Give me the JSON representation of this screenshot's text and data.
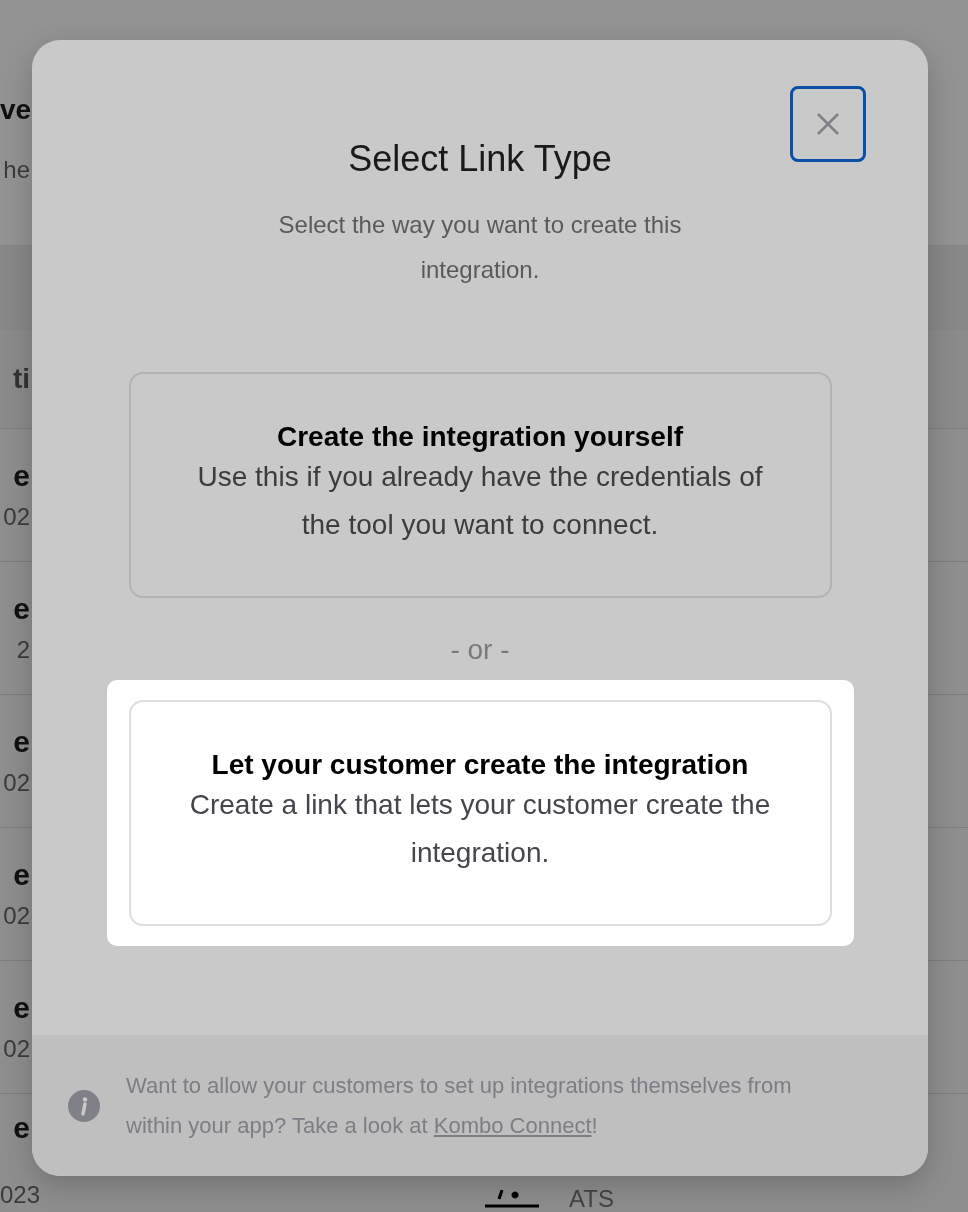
{
  "background": {
    "title": "ve",
    "subtitle": "he",
    "table_header": "ti",
    "rows": [
      {
        "name": "e",
        "date": "02"
      },
      {
        "name": "e",
        "date": "2"
      },
      {
        "name": "e",
        "date": "02"
      },
      {
        "name": "e",
        "date": "02"
      },
      {
        "name": "e",
        "date": "02"
      },
      {
        "name": "e",
        "date": "023",
        "category": "ATS"
      }
    ]
  },
  "dialog": {
    "title": "Select Link Type",
    "subtitle": "Select the way you want to create this integration.",
    "options": [
      {
        "title": "Create the integration yourself",
        "description": "Use this if you already have the credentials of the tool you want to connect.",
        "selected": false
      },
      {
        "title": "Let your customer create the integration",
        "description": "Create a link that lets your customer create the integration.",
        "selected": true
      }
    ],
    "separator": "- or -",
    "footer": {
      "text": "Want to allow your customers to set up integrations themselves from within your app? Take a look at ",
      "link": "Kombo Connect",
      "after": "!"
    }
  }
}
